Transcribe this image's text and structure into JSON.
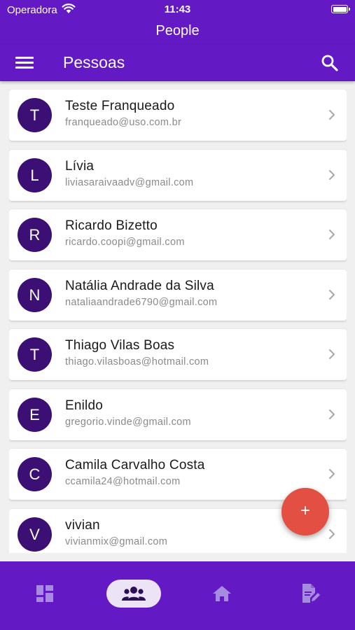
{
  "status_bar": {
    "carrier": "Operadora",
    "time": "11:43"
  },
  "nav_title": "People",
  "app_bar": {
    "title": "Pessoas",
    "menu_icon": "hamburger-menu-icon",
    "search_icon": "search-icon"
  },
  "people": [
    {
      "initial": "T",
      "name": "Teste Franqueado",
      "email": "franqueado@uso.com.br"
    },
    {
      "initial": "L",
      "name": "Lívia",
      "email": "liviasaraivaadv@gmail.com"
    },
    {
      "initial": "R",
      "name": "Ricardo Bizetto",
      "email": "ricardo.coopi@gmail.com"
    },
    {
      "initial": "N",
      "name": "Natália Andrade da Silva",
      "email": "nataliaandrade6790@gmail.com"
    },
    {
      "initial": "T",
      "name": "Thiago Vilas Boas",
      "email": "thiago.vilasboas@hotmail.com"
    },
    {
      "initial": "E",
      "name": "Enildo",
      "email": "gregorio.vinde@gmail.com"
    },
    {
      "initial": "C",
      "name": "Camila Carvalho Costa",
      "email": "ccamila24@hotmail.com"
    },
    {
      "initial": "V",
      "name": "vivian",
      "email": "vivianmix@gmail.com"
    }
  ],
  "fab": {
    "label": "+"
  },
  "bottom_nav": [
    {
      "icon": "dashboard-icon",
      "active": false
    },
    {
      "icon": "people-icon",
      "active": true
    },
    {
      "icon": "home-icon",
      "active": false
    },
    {
      "icon": "document-edit-icon",
      "active": false
    }
  ],
  "colors": {
    "primary": "#6319c4",
    "avatar": "#3c0f74",
    "fab": "#e35043",
    "active_tab": "#ece3f6",
    "inactive_icon": "#a78be0"
  }
}
